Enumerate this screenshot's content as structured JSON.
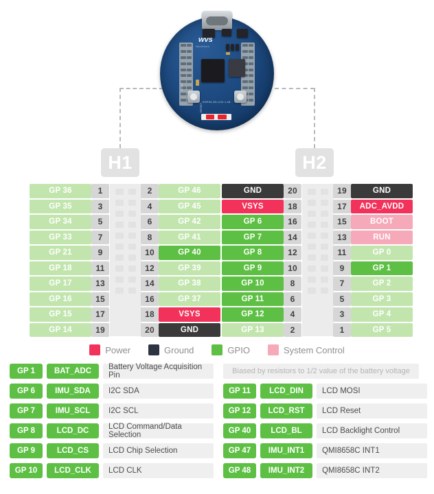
{
  "board": {
    "silkscreen_model": "ESP32-S3-LCD-1.28",
    "silkscreen_boot": "BOOT",
    "silkscreen_reset": "RESET",
    "brand": "wvs",
    "brand_sub": "Waveshare",
    "connector": "usb-c-port"
  },
  "headers": {
    "h1_label": "H1",
    "h2_label": "H2"
  },
  "colors": {
    "gpio_light": "#c2e5ae",
    "gpio": "#5dc044",
    "power": "#f2325a",
    "ground": "#3a3a3a",
    "system_control": "#f6a9b8",
    "pin_number_bg": "#d6d6d6",
    "strip_bg": "#ececec"
  },
  "h1": {
    "rows": [
      {
        "left_name": "GP 36",
        "left_type": "gpio_light",
        "left_num": "1",
        "right_num": "2",
        "right_name": "GP 46",
        "right_type": "gpio_light"
      },
      {
        "left_name": "GP 35",
        "left_type": "gpio_light",
        "left_num": "3",
        "right_num": "4",
        "right_name": "GP 45",
        "right_type": "gpio_light"
      },
      {
        "left_name": "GP 34",
        "left_type": "gpio_light",
        "left_num": "5",
        "right_num": "6",
        "right_name": "GP 42",
        "right_type": "gpio_light"
      },
      {
        "left_name": "GP 33",
        "left_type": "gpio_light",
        "left_num": "7",
        "right_num": "8",
        "right_name": "GP 41",
        "right_type": "gpio_light"
      },
      {
        "left_name": "GP 21",
        "left_type": "gpio_light",
        "left_num": "9",
        "right_num": "10",
        "right_name": "GP 40",
        "right_type": "gpio"
      },
      {
        "left_name": "GP 18",
        "left_type": "gpio_light",
        "left_num": "11",
        "right_num": "12",
        "right_name": "GP 39",
        "right_type": "gpio_light"
      },
      {
        "left_name": "GP 17",
        "left_type": "gpio_light",
        "left_num": "13",
        "right_num": "14",
        "right_name": "GP 38",
        "right_type": "gpio_light"
      },
      {
        "left_name": "GP 16",
        "left_type": "gpio_light",
        "left_num": "15",
        "right_num": "16",
        "right_name": "GP 37",
        "right_type": "gpio_light"
      },
      {
        "left_name": "GP 15",
        "left_type": "gpio_light",
        "left_num": "17",
        "right_num": "18",
        "right_name": "VSYS",
        "right_type": "power"
      },
      {
        "left_name": "GP 14",
        "left_type": "gpio_light",
        "left_num": "19",
        "right_num": "20",
        "right_name": "GND",
        "right_type": "ground"
      }
    ]
  },
  "h2": {
    "rows": [
      {
        "left_name": "GND",
        "left_type": "ground",
        "left_num": "20",
        "right_num": "19",
        "right_name": "GND",
        "right_type": "ground"
      },
      {
        "left_name": "VSYS",
        "left_type": "power",
        "left_num": "18",
        "right_num": "17",
        "right_name": "ADC_AVDD",
        "right_type": "power"
      },
      {
        "left_name": "GP 6",
        "left_type": "gpio",
        "left_num": "16",
        "right_num": "15",
        "right_name": "BOOT",
        "right_type": "system_control"
      },
      {
        "left_name": "GP 7",
        "left_type": "gpio",
        "left_num": "14",
        "right_num": "13",
        "right_name": "RUN",
        "right_type": "system_control"
      },
      {
        "left_name": "GP 8",
        "left_type": "gpio",
        "left_num": "12",
        "right_num": "11",
        "right_name": "GP 0",
        "right_type": "gpio_light"
      },
      {
        "left_name": "GP 9",
        "left_type": "gpio",
        "left_num": "10",
        "right_num": "9",
        "right_name": "GP 1",
        "right_type": "gpio"
      },
      {
        "left_name": "GP 10",
        "left_type": "gpio",
        "left_num": "8",
        "right_num": "7",
        "right_name": "GP 2",
        "right_type": "gpio_light"
      },
      {
        "left_name": "GP 11",
        "left_type": "gpio",
        "left_num": "6",
        "right_num": "5",
        "right_name": "GP 3",
        "right_type": "gpio_light"
      },
      {
        "left_name": "GP 12",
        "left_type": "gpio",
        "left_num": "4",
        "right_num": "3",
        "right_name": "GP 4",
        "right_type": "gpio_light"
      },
      {
        "left_name": "GP 13",
        "left_type": "gpio_light",
        "left_num": "2",
        "right_num": "1",
        "right_name": "GP 5",
        "right_type": "gpio_light"
      }
    ]
  },
  "legend": {
    "items": [
      {
        "label": "Power",
        "color": "#f2325a"
      },
      {
        "label": "Ground",
        "color": "#2b3440"
      },
      {
        "label": "GPIO",
        "color": "#5dc044"
      },
      {
        "label": "System Control",
        "color": "#f6a9b8"
      }
    ]
  },
  "functions": {
    "note": "Biased by resistors to 1/2 value of the battery voltage",
    "left": [
      {
        "gp": "GP 1",
        "fn": "BAT_ADC",
        "desc": "Battery Voltage Acquisition Pin"
      },
      {
        "gp": "GP 6",
        "fn": "IMU_SDA",
        "desc": "I2C SDA"
      },
      {
        "gp": "GP 7",
        "fn": "IMU_SCL",
        "desc": "I2C SCL"
      },
      {
        "gp": "GP 8",
        "fn": "LCD_DC",
        "desc": "LCD Command/Data Selection"
      },
      {
        "gp": "GP 9",
        "fn": "LCD_CS",
        "desc": "LCD Chip Selection"
      },
      {
        "gp": "GP 10",
        "fn": "LCD_CLK",
        "desc": "LCD CLK"
      }
    ],
    "right": [
      {
        "gp": "GP 11",
        "fn": "LCD_DIN",
        "desc": "LCD MOSI"
      },
      {
        "gp": "GP 12",
        "fn": "LCD_RST",
        "desc": "LCD Reset"
      },
      {
        "gp": "GP 40",
        "fn": "LCD_BL",
        "desc": "LCD Backlight Control"
      },
      {
        "gp": "GP 47",
        "fn": "IMU_INT1",
        "desc": "QMI8658C INT1"
      },
      {
        "gp": "GP 48",
        "fn": "IMU_INT2",
        "desc": "QMI8658C INT2"
      }
    ]
  }
}
